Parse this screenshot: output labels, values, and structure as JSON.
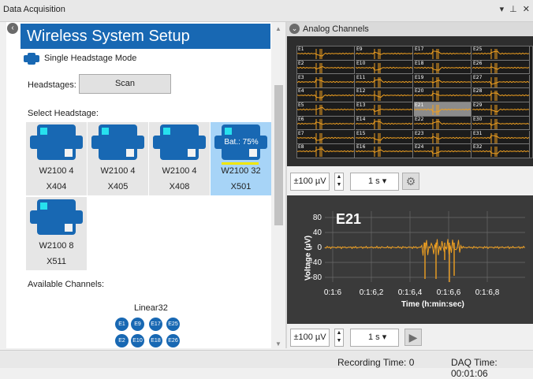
{
  "window": {
    "title": "Data Acquisition",
    "controls": "▾ ⊥ ✕"
  },
  "setup": {
    "title": "Wireless System Setup",
    "mode_label": "Single Headstage Mode",
    "headstages_label": "Headstages:",
    "scan_label": "Scan",
    "select_label": "Select Headstage:",
    "headstages": [
      {
        "name": "W2100 4",
        "code": "X404",
        "selected": false
      },
      {
        "name": "W2100 4",
        "code": "X405",
        "selected": false
      },
      {
        "name": "W2100 4",
        "code": "X408",
        "selected": false
      },
      {
        "name": "W2100 32",
        "code": "X501",
        "selected": true,
        "battery": "Bat.: 75%"
      },
      {
        "name": "W2100 8",
        "code": "X511",
        "selected": false
      }
    ],
    "available_label": "Available Channels:",
    "linear_label": "Linear32",
    "channels_row1": [
      "E1",
      "E9",
      "E17",
      "E25"
    ],
    "channels_row2": [
      "E2",
      "E10",
      "E18",
      "E26"
    ]
  },
  "analog": {
    "header": "Analog Channels",
    "channels": [
      "E1",
      "E9",
      "E17",
      "E25",
      "E2",
      "E10",
      "E18",
      "E26",
      "E3",
      "E11",
      "E19",
      "E27",
      "E4",
      "E12",
      "E20",
      "E28",
      "E5",
      "E13",
      "E21",
      "E29",
      "E6",
      "E14",
      "E22",
      "E30",
      "E7",
      "E15",
      "E23",
      "E31",
      "E8",
      "E16",
      "E24",
      "E32"
    ],
    "highlighted": "E21",
    "top_controls": {
      "scale": "±100 µV",
      "time": "1 s ▾",
      "settings_icon": "gear-icon"
    },
    "bottom_controls": {
      "scale": "±100 µV",
      "time": "1 s ▾",
      "play_icon": "play-icon"
    }
  },
  "plot": {
    "channel": "E21",
    "ylabel": "Voltage (µV)",
    "xlabel": "Time (h:min:sec)",
    "yticks": [
      "80",
      "40",
      "0",
      "-40",
      "-80"
    ],
    "xticks": [
      "0:1:6",
      "0:1:6,2",
      "0:1:6,4",
      "0:1:6,6",
      "0:1:6,8"
    ]
  },
  "status": {
    "recording": "Recording Time: 0",
    "daq": "DAQ Time: 00:01:06"
  },
  "colors": {
    "accent": "#1868b3",
    "trace": "#f0a020",
    "led": "#27e0ee",
    "battery": "#f0e600"
  }
}
